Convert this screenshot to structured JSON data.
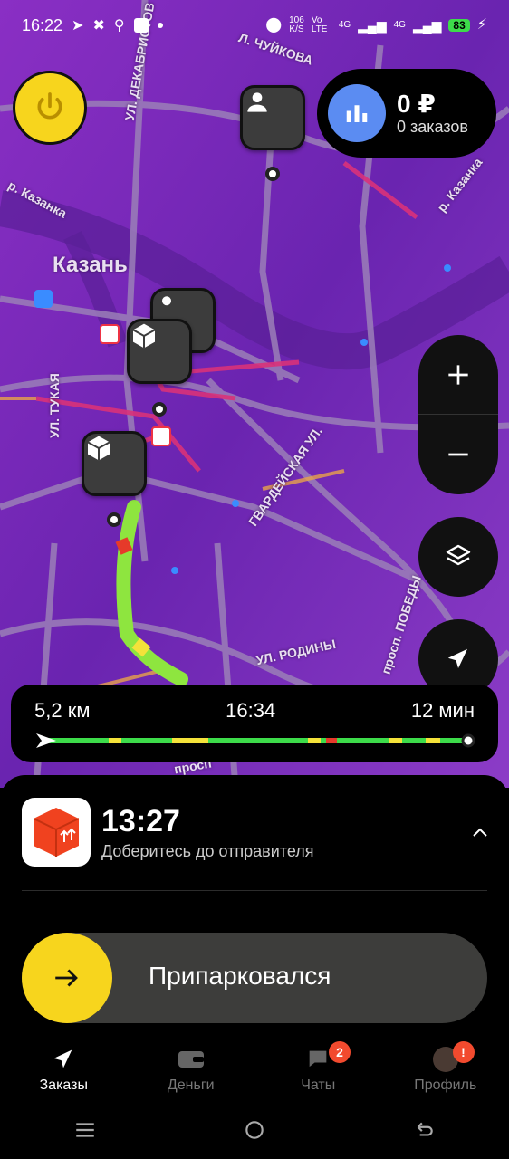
{
  "status_bar": {
    "time": "16:22",
    "speed_value": "106",
    "speed_unit": "K/S",
    "net_label": "Vo LTE",
    "signal_1": "4G",
    "signal_2": "4G",
    "battery": "83"
  },
  "map": {
    "city_label": "Казань",
    "streets": {
      "chuykova": "Л. ЧУЙКОВА",
      "dekabristov": "УЛ. ДЕКАБРИСТОВ",
      "kazanka_left": "р. Казанка",
      "kazanka_right": "р. Казанка",
      "tukaya": "УЛ. ТУКАЯ",
      "gvardeyskaya": "ГВАРДЕЙСКАЯ УЛ.",
      "rodiny": "УЛ. РОДИНЫ",
      "pobedy": "просп. ПОБЕДЫ",
      "prospekt_bottom": "просп"
    }
  },
  "stats": {
    "amount": "0 ₽",
    "orders": "0 заказов"
  },
  "route": {
    "distance": "5,2 км",
    "arrival": "16:34",
    "duration": "12 мин"
  },
  "order": {
    "time": "13:27",
    "subtitle": "Доберитесь до отправителя"
  },
  "action": {
    "slider_label": "Припарковался"
  },
  "nav": {
    "orders": "Заказы",
    "money": "Деньги",
    "chats": "Чаты",
    "chats_badge": "2",
    "profile": "Профиль",
    "profile_badge": "!"
  },
  "colors": {
    "accent_yellow": "#f7d51d",
    "stats_blue": "#5b8cf2",
    "route_green": "#8ee53f",
    "badge_red": "#f24a2e"
  }
}
